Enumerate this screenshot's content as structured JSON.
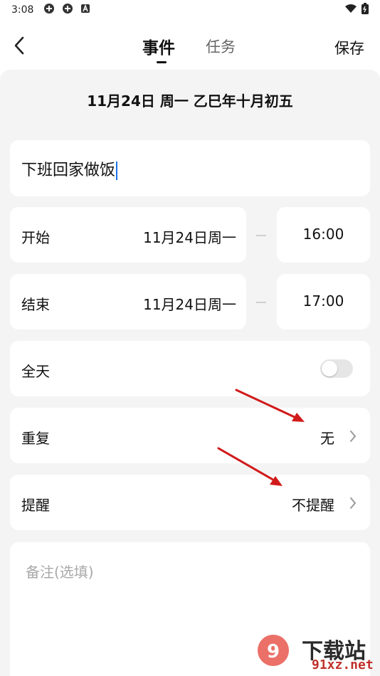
{
  "status_bar": {
    "time": "3:08"
  },
  "header": {
    "tab_event": "事件",
    "tab_task": "任务",
    "save_label": "保存"
  },
  "date_title": "11月24日 周一 乙巳年十月初五",
  "event_title_value": "下班回家做饭",
  "start": {
    "label": "开始",
    "date": "11月24日周一",
    "time": "16:00"
  },
  "end": {
    "label": "结束",
    "date": "11月24日周一",
    "time": "17:00"
  },
  "all_day": {
    "label": "全天",
    "enabled": false
  },
  "repeat": {
    "label": "重复",
    "value": "无"
  },
  "reminder": {
    "label": "提醒",
    "value": "不提醒"
  },
  "notes": {
    "placeholder": "备注(选填)"
  },
  "watermark": {
    "brand": "下载站",
    "site": "91xz.net"
  },
  "colors": {
    "annotation_arrow": "#d11a1a",
    "caret": "#1a73e8"
  }
}
